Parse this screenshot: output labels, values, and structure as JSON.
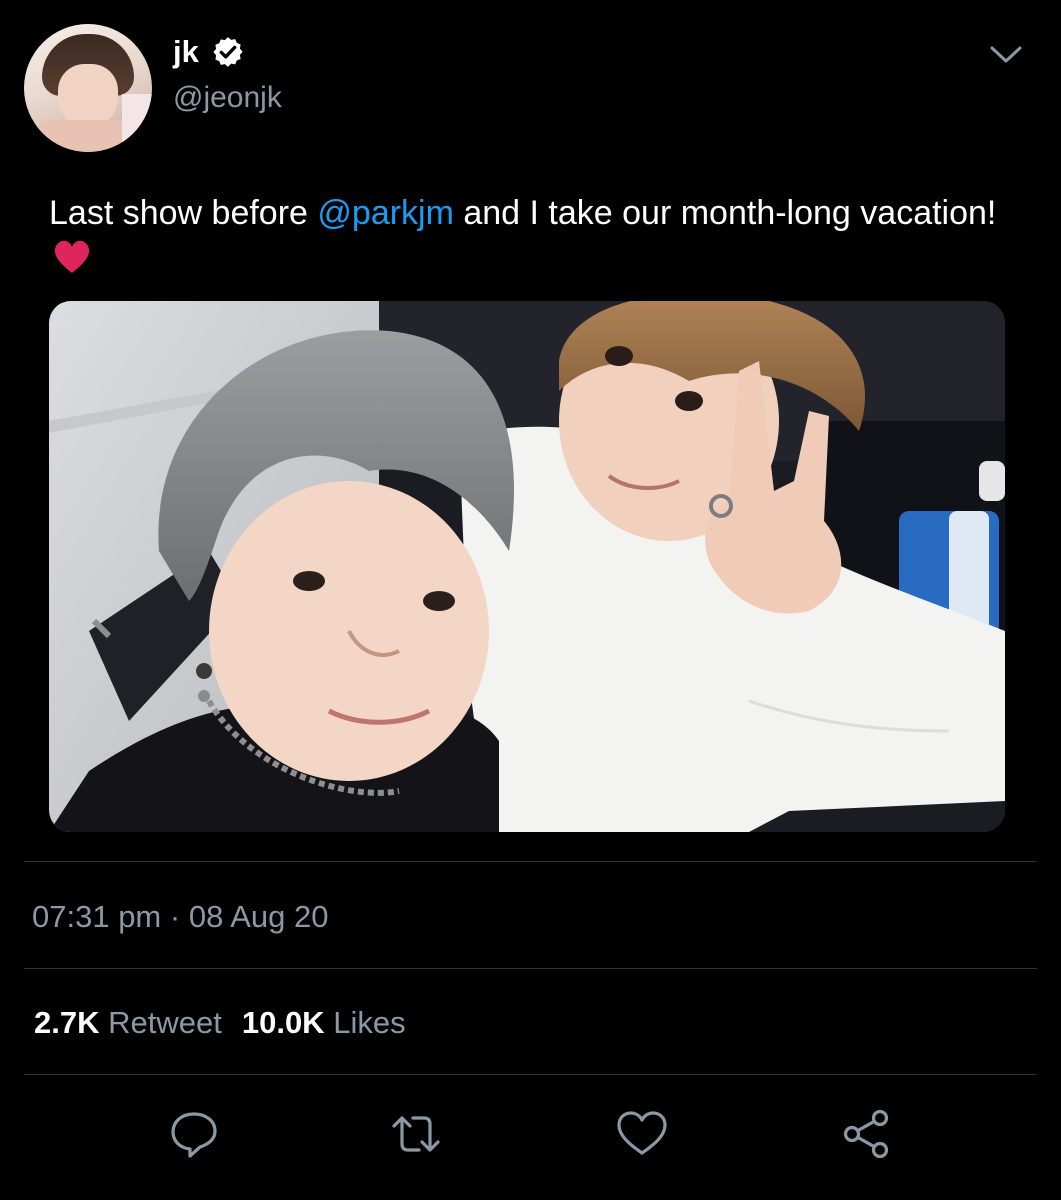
{
  "header": {
    "display_name": "jk",
    "handle": "@jeonjk",
    "verified": true
  },
  "tweet": {
    "text_before": "Last show before ",
    "mention": "@parkjm",
    "text_after": " and I take our month-long vacation! ",
    "emoji": "red-heart"
  },
  "meta": {
    "time": "07:31 pm",
    "separator": " · ",
    "date": "08 Aug 20"
  },
  "stats": {
    "retweet_count": "2.7K",
    "retweet_label": "Retweet",
    "like_count": "10.0K",
    "like_label": "Likes"
  },
  "actions": [
    {
      "icon": "reply-icon"
    },
    {
      "icon": "retweet-icon"
    },
    {
      "icon": "like-icon"
    },
    {
      "icon": "share-icon"
    }
  ],
  "colors": {
    "background": "#000000",
    "accent": "#1d9bf0",
    "muted_text": "#8b98a5",
    "divider": "#2f3336",
    "heart": "#e0245e"
  }
}
